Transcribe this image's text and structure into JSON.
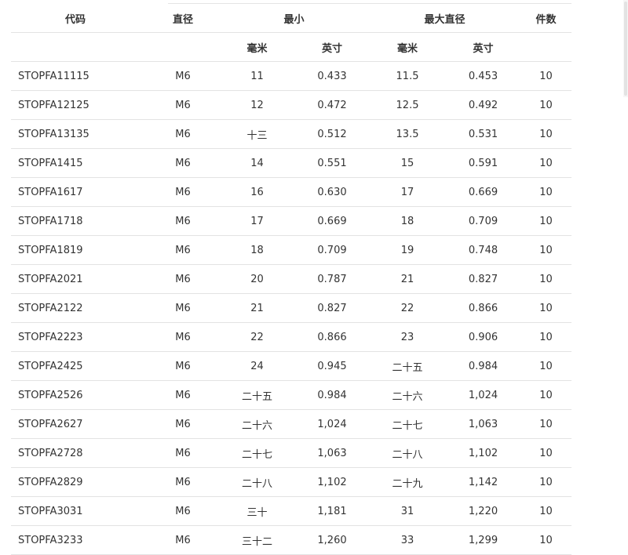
{
  "header": {
    "code": "代码",
    "diameter": "直径",
    "min": "最小",
    "max_diameter": "最大直径",
    "pieces": "件数",
    "mm": "毫米",
    "inch": "英寸"
  },
  "rows": [
    {
      "code": "STOPFA11115",
      "thread": "M6",
      "min_mm": "11",
      "min_in": "0.433",
      "max_mm": "11.5",
      "max_in": "0.453",
      "qty": "10"
    },
    {
      "code": "STOPFA12125",
      "thread": "M6",
      "min_mm": "12",
      "min_in": "0.472",
      "max_mm": "12.5",
      "max_in": "0.492",
      "qty": "10"
    },
    {
      "code": "STOPFA13135",
      "thread": "M6",
      "min_mm": "十三",
      "min_in": "0.512",
      "max_mm": "13.5",
      "max_in": "0.531",
      "qty": "10"
    },
    {
      "code": "STOPFA1415",
      "thread": "M6",
      "min_mm": "14",
      "min_in": "0.551",
      "max_mm": "15",
      "max_in": "0.591",
      "qty": "10"
    },
    {
      "code": "STOPFA1617",
      "thread": "M6",
      "min_mm": "16",
      "min_in": "0.630",
      "max_mm": "17",
      "max_in": "0.669",
      "qty": "10"
    },
    {
      "code": "STOPFA1718",
      "thread": "M6",
      "min_mm": "17",
      "min_in": "0.669",
      "max_mm": "18",
      "max_in": "0.709",
      "qty": "10"
    },
    {
      "code": "STOPFA1819",
      "thread": "M6",
      "min_mm": "18",
      "min_in": "0.709",
      "max_mm": "19",
      "max_in": "0.748",
      "qty": "10"
    },
    {
      "code": "STOPFA2021",
      "thread": "M6",
      "min_mm": "20",
      "min_in": "0.787",
      "max_mm": "21",
      "max_in": "0.827",
      "qty": "10"
    },
    {
      "code": "STOPFA2122",
      "thread": "M6",
      "min_mm": "21",
      "min_in": "0.827",
      "max_mm": "22",
      "max_in": "0.866",
      "qty": "10"
    },
    {
      "code": "STOPFA2223",
      "thread": "M6",
      "min_mm": "22",
      "min_in": "0.866",
      "max_mm": "23",
      "max_in": "0.906",
      "qty": "10"
    },
    {
      "code": "STOPFA2425",
      "thread": "M6",
      "min_mm": "24",
      "min_in": "0.945",
      "max_mm": "二十五",
      "max_in": "0.984",
      "qty": "10"
    },
    {
      "code": "STOPFA2526",
      "thread": "M6",
      "min_mm": "二十五",
      "min_in": "0.984",
      "max_mm": "二十六",
      "max_in": "1,024",
      "qty": "10"
    },
    {
      "code": "STOPFA2627",
      "thread": "M6",
      "min_mm": "二十六",
      "min_in": "1,024",
      "max_mm": "二十七",
      "max_in": "1,063",
      "qty": "10"
    },
    {
      "code": "STOPFA2728",
      "thread": "M6",
      "min_mm": "二十七",
      "min_in": "1,063",
      "max_mm": "二十八",
      "max_in": "1,102",
      "qty": "10"
    },
    {
      "code": "STOPFA2829",
      "thread": "M6",
      "min_mm": "二十八",
      "min_in": "1,102",
      "max_mm": "二十九",
      "max_in": "1,142",
      "qty": "10"
    },
    {
      "code": "STOPFA3031",
      "thread": "M6",
      "min_mm": "三十",
      "min_in": "1,181",
      "max_mm": "31",
      "max_in": "1,220",
      "qty": "10"
    },
    {
      "code": "STOPFA3233",
      "thread": "M6",
      "min_mm": "三十二",
      "min_in": "1,260",
      "max_mm": "33",
      "max_in": "1,299",
      "qty": "10"
    }
  ]
}
